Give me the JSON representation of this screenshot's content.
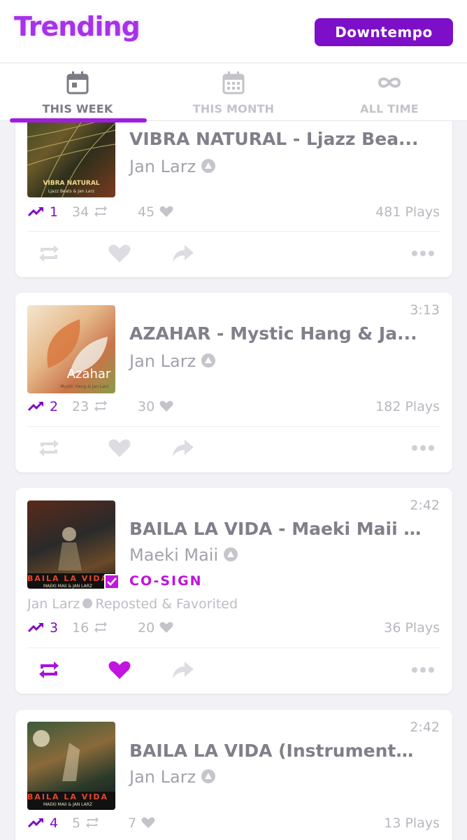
{
  "header": {
    "title": "Trending",
    "genre_button": "Downtempo"
  },
  "tabs": [
    {
      "label": "THIS WEEK",
      "icon": "calendar-day-icon",
      "active": true
    },
    {
      "label": "THIS MONTH",
      "icon": "calendar-month-icon",
      "active": false
    },
    {
      "label": "ALL TIME",
      "icon": "infinity-icon",
      "active": false
    }
  ],
  "colors": {
    "accent": "#7e0fc8",
    "title": "#a633e8",
    "cosign": "#c115e0",
    "muted": "#b8b7bf"
  },
  "tracks": [
    {
      "title": "VIBRA NATURAL - Ljazz Bea...",
      "artist": "Jan Larz",
      "duration": "",
      "rank": "1",
      "reposts": "34",
      "favorites": "45",
      "plays": "481 Plays",
      "art_text": "VIBRA NATURAL",
      "art_sub": "Ljazz Beats & Jan Larz"
    },
    {
      "title": "AZAHAR - Mystic Hang & Ja...",
      "artist": "Jan Larz",
      "duration": "3:13",
      "rank": "2",
      "reposts": "23",
      "favorites": "30",
      "plays": "182 Plays",
      "art_text": "Azahar",
      "art_sub": "Mystic Hang & Jan Larz"
    },
    {
      "title": "BAILA LA VIDA - Maeki Maii ...",
      "artist": "Maeki Maii",
      "duration": "2:42",
      "rank": "3",
      "reposts": "16",
      "favorites": "20",
      "plays": "36 Plays",
      "cosign": "CO-SIGN",
      "repost_user": "Jan Larz",
      "repost_text": "Reposted & Favorited",
      "art_text": "BAILA LA VIDA",
      "art_sub": "MAEKI MAII & JAN LARZ"
    },
    {
      "title": "BAILA LA VIDA (Instrumenta...",
      "artist": "Jan Larz",
      "duration": "2:42",
      "rank": "4",
      "reposts": "5",
      "favorites": "7",
      "plays": "13 Plays",
      "art_text": "BAILA LA VIDA",
      "art_sub": "MAEKI MAII & JAN LARZ"
    }
  ]
}
